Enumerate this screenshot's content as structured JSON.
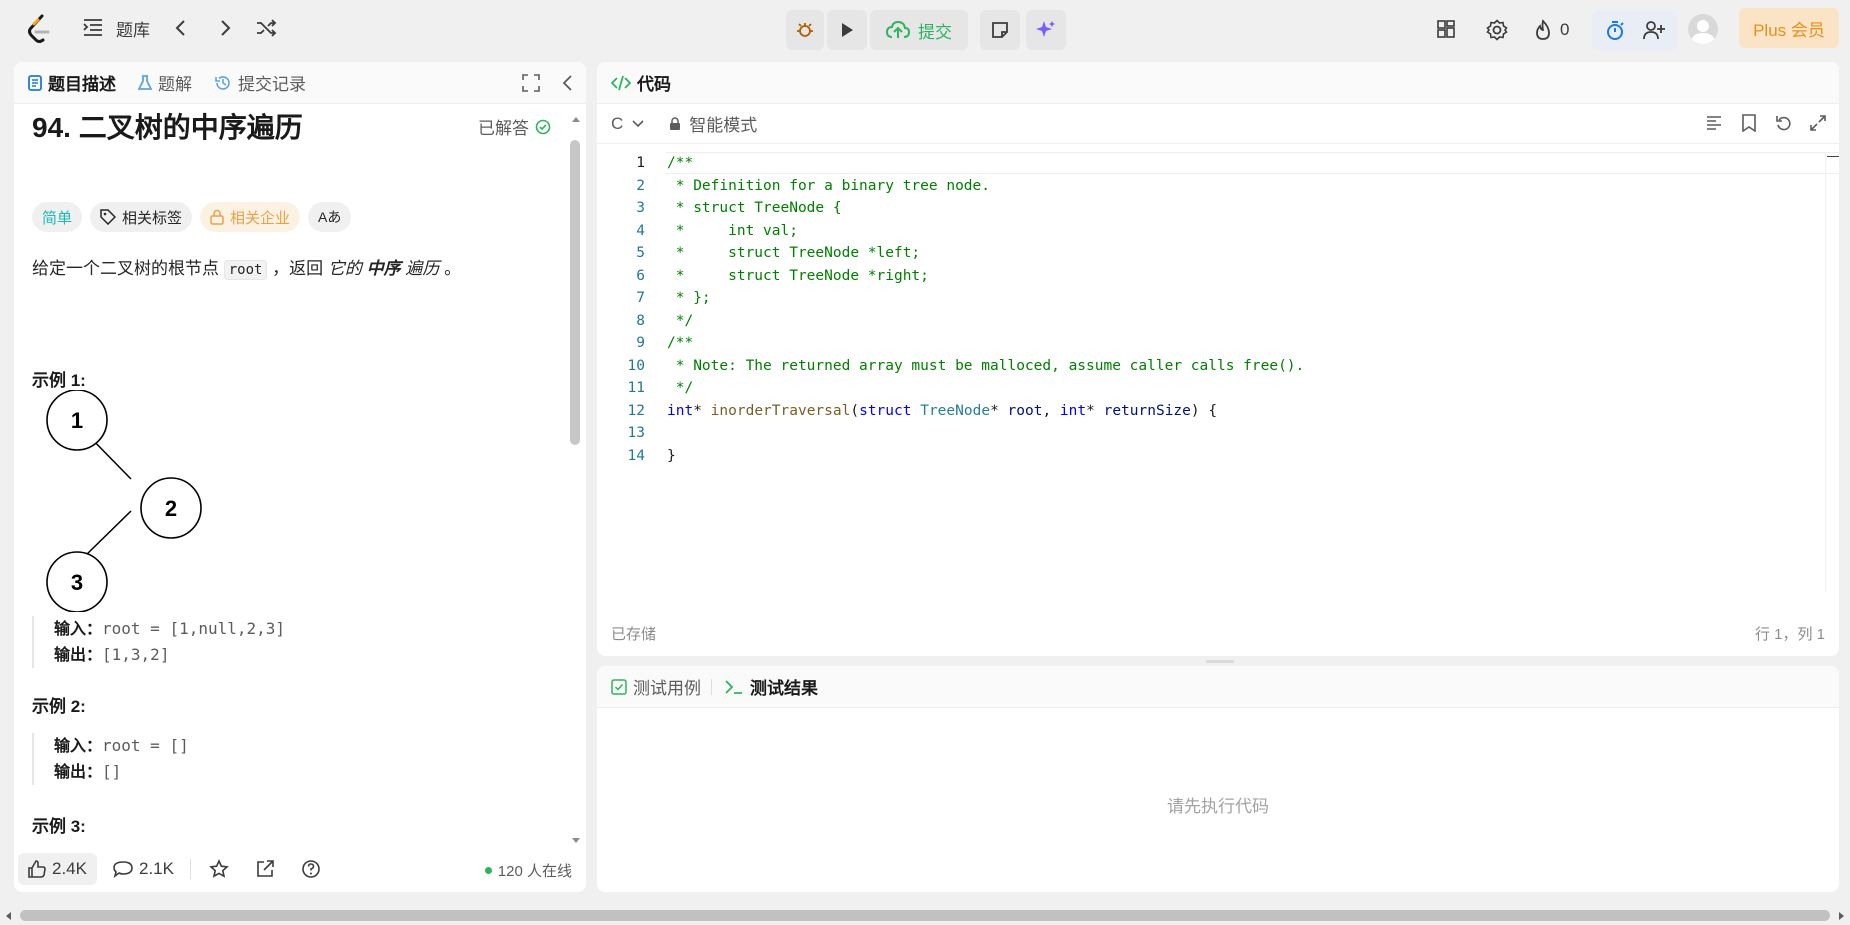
{
  "topbar": {
    "nav_label": "题库",
    "submit_label": "提交",
    "streak_count": "0",
    "plus_label": "Plus 会员"
  },
  "left": {
    "tabs": [
      {
        "label": "题目描述"
      },
      {
        "label": "题解"
      },
      {
        "label": "提交记录"
      }
    ],
    "title": "94. 二叉树的中序遍历",
    "solved_label": "已解答",
    "tags": {
      "difficulty": "简单",
      "related_tags": "相关标签",
      "related_companies": "相关企业",
      "translate": "Aあ"
    },
    "question": {
      "prefix": "给定一个二叉树的根节点 ",
      "code": "root",
      "mid": " ，返回 ",
      "italic1": "它的 ",
      "bold": "中序",
      "italic2": " 遍历",
      "suffix": " 。"
    },
    "examples": [
      {
        "heading": "示例 1:",
        "input_label": "输入：",
        "input": "root = [1,null,2,3]",
        "output_label": "输出：",
        "output": "[1,3,2]"
      },
      {
        "heading": "示例 2:",
        "input_label": "输入：",
        "input": "root = []",
        "output_label": "输出：",
        "output": "[]"
      },
      {
        "heading": "示例 3:"
      }
    ],
    "tree_nodes": [
      "1",
      "2",
      "3"
    ],
    "footer": {
      "likes": "2.4K",
      "comments": "2.1K",
      "online": "120 人在线"
    }
  },
  "code": {
    "tab_label": "代码",
    "language": "C",
    "mode": "智能模式",
    "line_numbers": [
      "1",
      "2",
      "3",
      "4",
      "5",
      "6",
      "7",
      "8",
      "9",
      "10",
      "11",
      "12",
      "13",
      "14"
    ],
    "lines": [
      "/**",
      " * Definition for a binary tree node.",
      " * struct TreeNode {",
      " *     int val;",
      " *     struct TreeNode *left;",
      " *     struct TreeNode *right;",
      " * };",
      " */",
      "/**",
      " * Note: The returned array must be malloced, assume caller calls free().",
      " */",
      "",
      "",
      "}"
    ],
    "signature": {
      "t1": "int",
      "s1": "* ",
      "fn": "inorderTraversal",
      "s2": "(",
      "kw": "struct",
      "s3": " ",
      "ty": "TreeNode",
      "s4": "* ",
      "p1": "root",
      "s5": ", ",
      "t2": "int",
      "s6": "* ",
      "p2": "returnSize",
      "s7": ") {"
    },
    "saved_label": "已存储",
    "cursor_pos": "行 1，列 1"
  },
  "result": {
    "tabs": [
      {
        "label": "测试用例"
      },
      {
        "label": "测试结果"
      }
    ],
    "empty_text": "请先执行代码"
  }
}
